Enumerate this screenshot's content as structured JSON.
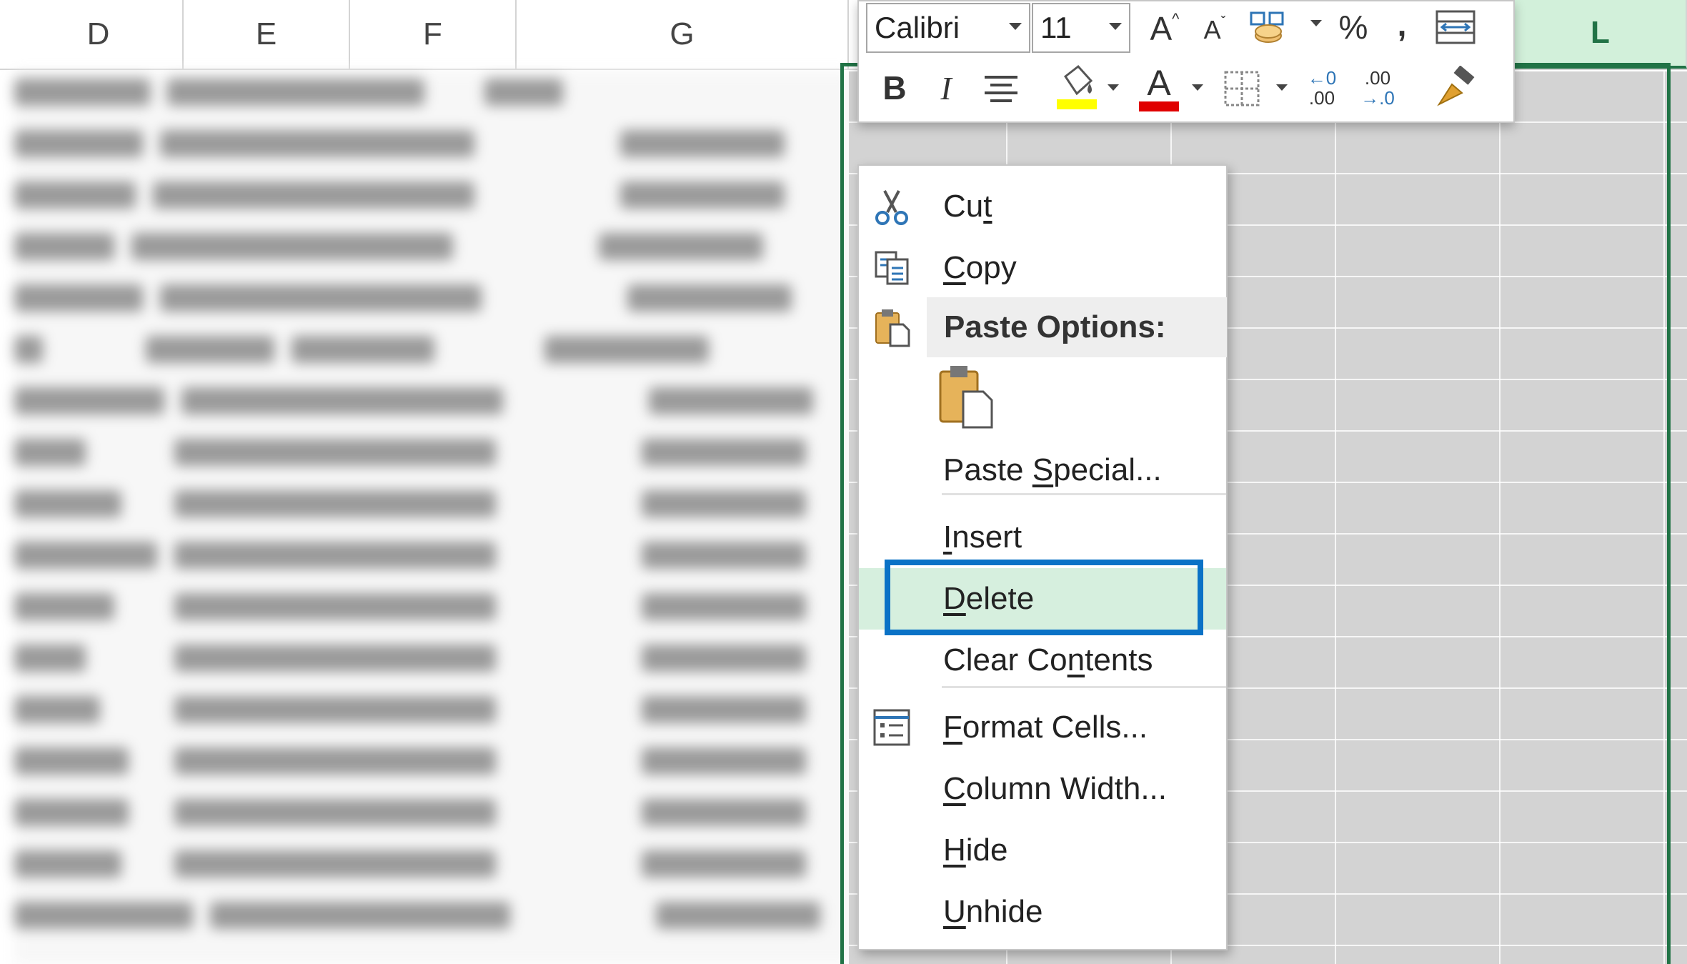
{
  "columns": [
    "D",
    "E",
    "F",
    "G",
    "L"
  ],
  "mini_toolbar": {
    "font_name": "Calibri",
    "font_size": "11",
    "increase_font_glyph": "A",
    "decrease_font_glyph": "A",
    "percent_glyph": "%",
    "comma_glyph": ",",
    "bold_glyph": "B",
    "italic_glyph": "I",
    "font_color_glyph": "A",
    "increase_decimal_top": "←0",
    "increase_decimal_bottom": ".00",
    "decrease_decimal_top": ".00",
    "decrease_decimal_bottom": "→.0",
    "fill_color": "#ffff00",
    "font_color": "#e00000"
  },
  "context_menu": {
    "items": [
      {
        "pre": "",
        "key": "t",
        "post": "",
        "full": "Cut",
        "icon": "scissors-icon"
      },
      {
        "pre": "",
        "key": "C",
        "post": "opy",
        "full": "Copy",
        "icon": "copy-icon"
      },
      {
        "header": "Paste Options:",
        "icon": "paste-icon"
      },
      {
        "pre": "Paste ",
        "key": "S",
        "post": "pecial...",
        "full": "Paste Special..."
      },
      {
        "pre": "",
        "key": "I",
        "post": "nsert",
        "full": "Insert"
      },
      {
        "pre": "",
        "key": "D",
        "post": "elete",
        "full": "Delete"
      },
      {
        "pre": "Clear Co",
        "key": "n",
        "post": "tents",
        "full": "Clear Contents"
      },
      {
        "pre": "",
        "key": "F",
        "post": "ormat Cells...",
        "full": "Format Cells...",
        "icon": "format-cells-icon"
      },
      {
        "pre": "",
        "key": "C",
        "post": "olumn Width...",
        "full": "Column Width..."
      },
      {
        "pre": "",
        "key": "H",
        "post": "ide",
        "full": "Hide"
      },
      {
        "pre": "",
        "key": "U",
        "post": "nhide",
        "full": "Unhide"
      }
    ]
  },
  "colors": {
    "selection_green": "#217346",
    "highlight_blue": "#0a72c6",
    "delete_bg": "#d6efde"
  }
}
